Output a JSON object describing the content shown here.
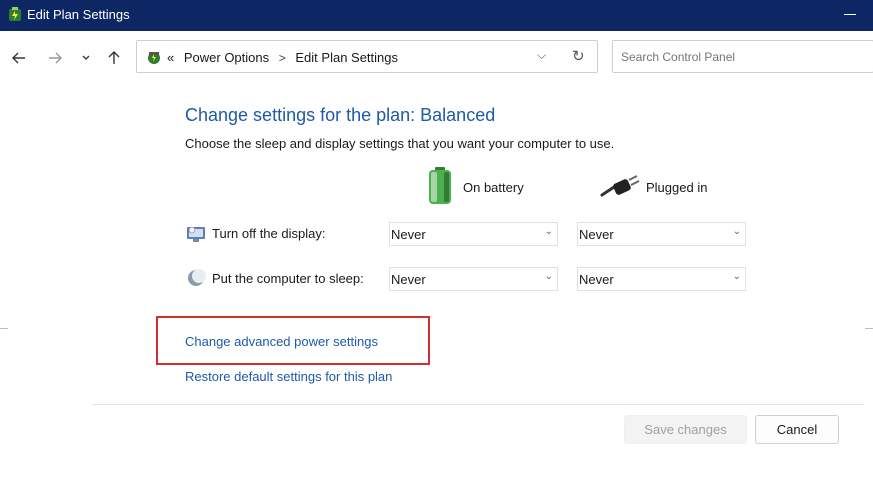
{
  "window": {
    "title": "Edit Plan Settings"
  },
  "nav": {
    "back_icon": "arrow-left-icon",
    "forward_icon": "arrow-right-icon",
    "recent_icon": "chevron-down-icon",
    "up_icon": "arrow-up-icon"
  },
  "address": {
    "prefix": "«",
    "crumbs": [
      "Power Options",
      "Edit Plan Settings"
    ],
    "separator": ">",
    "dropdown_glyph": "⌵",
    "refresh_glyph": "↻"
  },
  "search": {
    "placeholder": "Search Control Panel"
  },
  "main": {
    "heading": "Change settings for the plan: Balanced",
    "subtitle": "Choose the sleep and display settings that you want your computer to use.",
    "columns": {
      "battery": "On battery",
      "plugged": "Plugged in"
    },
    "rows": [
      {
        "label": "Turn off the display:",
        "battery_value": "Never",
        "plugged_value": "Never"
      },
      {
        "label": "Put the computer to sleep:",
        "battery_value": "Never",
        "plugged_value": "Never"
      }
    ],
    "links": {
      "advanced": "Change advanced power settings",
      "restore": "Restore default settings for this plan"
    }
  },
  "footer": {
    "save_label": "Save changes",
    "cancel_label": "Cancel"
  },
  "colors": {
    "titlebar": "#0c2764",
    "link": "#1e5aa8",
    "highlight": "#d32f2f"
  }
}
